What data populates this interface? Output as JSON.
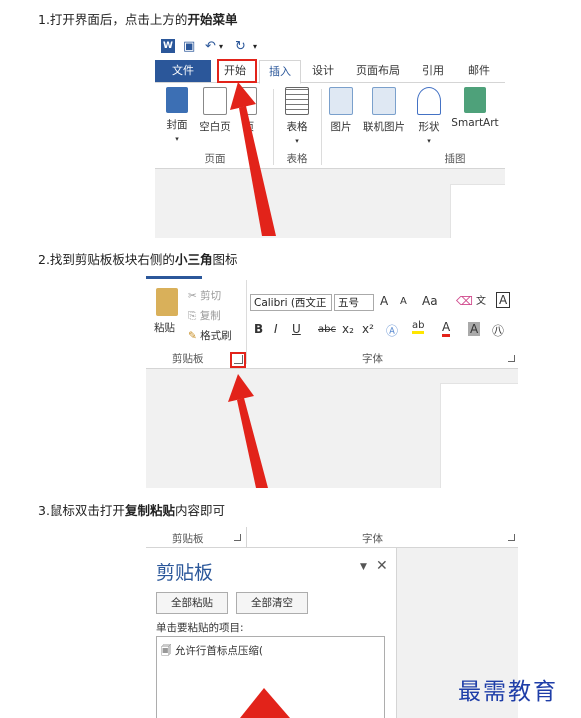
{
  "steps": [
    {
      "prefix": "1.打开界面后，点击上方的",
      "bold": "开始菜单",
      "suffix": ""
    },
    {
      "prefix": "2.找到剪贴板板块右侧的",
      "bold": "小三角",
      "suffix": "图标"
    },
    {
      "prefix": "3.鼠标双击打开",
      "bold": "复制粘贴",
      "suffix": "内容即可"
    }
  ],
  "shot1": {
    "tabs": [
      "文件",
      "开始",
      "插入",
      "设计",
      "页面布局",
      "引用",
      "邮件"
    ],
    "pages_group": {
      "label": "页面",
      "items": [
        "封面",
        "空白页",
        "页"
      ]
    },
    "tables_group": {
      "label": "表格",
      "items": [
        "表格"
      ]
    },
    "illustrations_group": {
      "label": "插图",
      "items": [
        "图片",
        "联机图片",
        "形状",
        "SmartArt"
      ]
    }
  },
  "shot2": {
    "clipboard": {
      "paste": "粘贴",
      "cut": "剪切",
      "copy": "复制",
      "format_painter": "格式刷",
      "label": "剪贴板"
    },
    "font": {
      "family": "Calibri (西文正",
      "size": "五号",
      "label": "字体",
      "grow": "A",
      "shrink": "A",
      "change_case": "Aa",
      "bold": "B",
      "italic": "I",
      "underline": "U",
      "strike": "abc",
      "subscript": "x₂",
      "superscript": "x²",
      "font_color": "A",
      "highlight": "ab",
      "shade": "A"
    }
  },
  "shot3": {
    "clipboard_label": "剪贴板",
    "font_label": "字体",
    "panel_title": "剪贴板",
    "paste_all": "全部粘贴",
    "clear_all": "全部清空",
    "prompt": "单击要粘贴的项目:",
    "item": "允许行首标点压缩("
  },
  "watermark": "最需教育",
  "colors": {
    "word_blue": "#2b579a",
    "highlight_red": "#e2231a",
    "watermark_blue": "#1f3ea8"
  }
}
